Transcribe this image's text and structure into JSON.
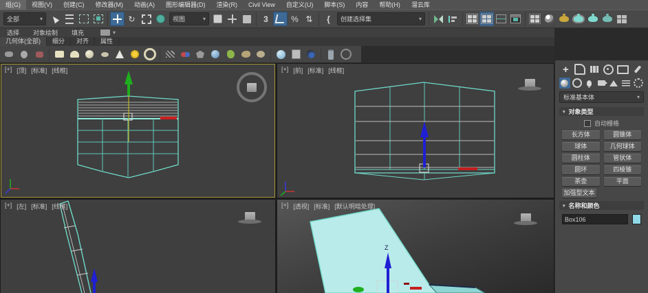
{
  "theme": {
    "accent_blue": "#3d6a96",
    "object_wire": "#6fd9c9",
    "object_fill": "#b9ebea",
    "axis_x_red": "#cc2222",
    "axis_y_green": "#1fae1f",
    "axis_z_blue": "#1f1fd4",
    "active_viewport_border": "#a7963b"
  },
  "menu": {
    "items": [
      "组(G)",
      "视图(V)",
      "创建(C)",
      "修改器(M)",
      "动画(A)",
      "图形编辑器(D)",
      "渲染(R)",
      "Civil View",
      "自定义(U)",
      "脚本(S)",
      "内容",
      "帮助(H)",
      "溜云库"
    ]
  },
  "toolbar": {
    "selection_filter": "全部",
    "coordinate_system": "视图",
    "named_selection_sets": "创建选择集",
    "snap_3d_label": "3",
    "percent_label": "%",
    "braces_label": "{",
    "icons": [
      "select-object",
      "select-by-name",
      "rectangular-selection-region",
      "window-crossing",
      "select-and-move",
      "select-and-rotate",
      "select-and-scale",
      "select-and-place",
      "use-pivot-point-center",
      "select-and-manipulate",
      "keyboard-shortcut-override",
      "snap-toggle-3d",
      "angle-snap-toggle",
      "percent-snap-toggle",
      "spinner-snap-toggle",
      "edit-named-selection-sets",
      "mirror",
      "align",
      "toggle-scene-explorer",
      "toggle-layer-explorer",
      "curve-editor",
      "dope-sheet",
      "slate-material-editor",
      "material-editor",
      "render-setup",
      "rendered-frame-window",
      "render-production",
      "render-iterative",
      "viewport-layout-tabs"
    ]
  },
  "ribbon": {
    "tabs": [
      "选择",
      "对象绘制",
      "填充"
    ],
    "panels": [
      "几何体(全部)",
      "细分",
      "对齐",
      "属性"
    ]
  },
  "viewports": {
    "top": {
      "label": [
        "[+]",
        "[顶]",
        "[标准]",
        "[线框]"
      ]
    },
    "front": {
      "label": [
        "[+]",
        "[前]",
        "[标准]",
        "[线框]"
      ]
    },
    "left": {
      "label": [
        "[+]",
        "[左]",
        "[标准]",
        "[线框]"
      ]
    },
    "perspective": {
      "label": [
        "[+]",
        "[透视]",
        "[标准]",
        "[默认明暗处理]"
      ],
      "axis_label": "Z"
    }
  },
  "command_panel": {
    "tabs": [
      "create",
      "modify",
      "hierarchy",
      "motion",
      "display",
      "utilities"
    ],
    "categories": [
      "geometry",
      "shapes",
      "lights",
      "cameras",
      "helpers",
      "space-warps",
      "systems"
    ],
    "category_dropdown": "标准基本体",
    "object_type_rollout": "对象类型",
    "autogrid_label": "自动栅格",
    "object_type_buttons": [
      "长方体",
      "圆锥体",
      "球体",
      "几何球体",
      "圆柱体",
      "管状体",
      "圆环",
      "四棱锥",
      "茶壶",
      "平面",
      "加强型文本"
    ],
    "name_color_rollout": "名称和颜色",
    "object_name": "Box106",
    "object_color": "#8fd9e8"
  },
  "glyphs": {
    "caret": "▾",
    "rotate": "↻",
    "updown": "⇅",
    "plus": "+"
  }
}
